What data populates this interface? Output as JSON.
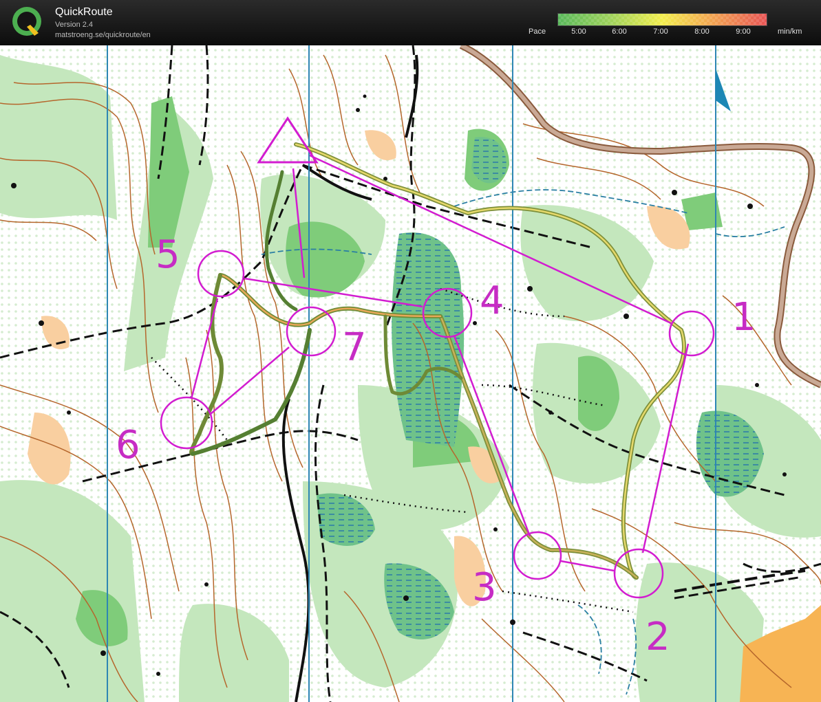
{
  "header": {
    "app_name": "QuickRoute",
    "version": "Version 2.4",
    "url": "matstroeng.se/quickroute/en",
    "logo_letter": "Q",
    "pace_label": "Pace",
    "pace_ticks": [
      "5:00",
      "6:00",
      "7:00",
      "8:00",
      "9:00"
    ],
    "pace_unit": "min/km"
  },
  "colors": {
    "course": "#d21cd0",
    "control_number": "#c62cc4",
    "pace_fast": "#5cb85c",
    "pace_mid": "#e8e84a",
    "pace_slow": "#e05050"
  },
  "controls": [
    {
      "label": "1"
    },
    {
      "label": "2"
    },
    {
      "label": "3"
    },
    {
      "label": "4"
    },
    {
      "label": "5"
    },
    {
      "label": "6"
    },
    {
      "label": "7"
    }
  ],
  "icons": {
    "north_arrow": "north-arrow-icon",
    "start": "start-triangle-icon"
  }
}
